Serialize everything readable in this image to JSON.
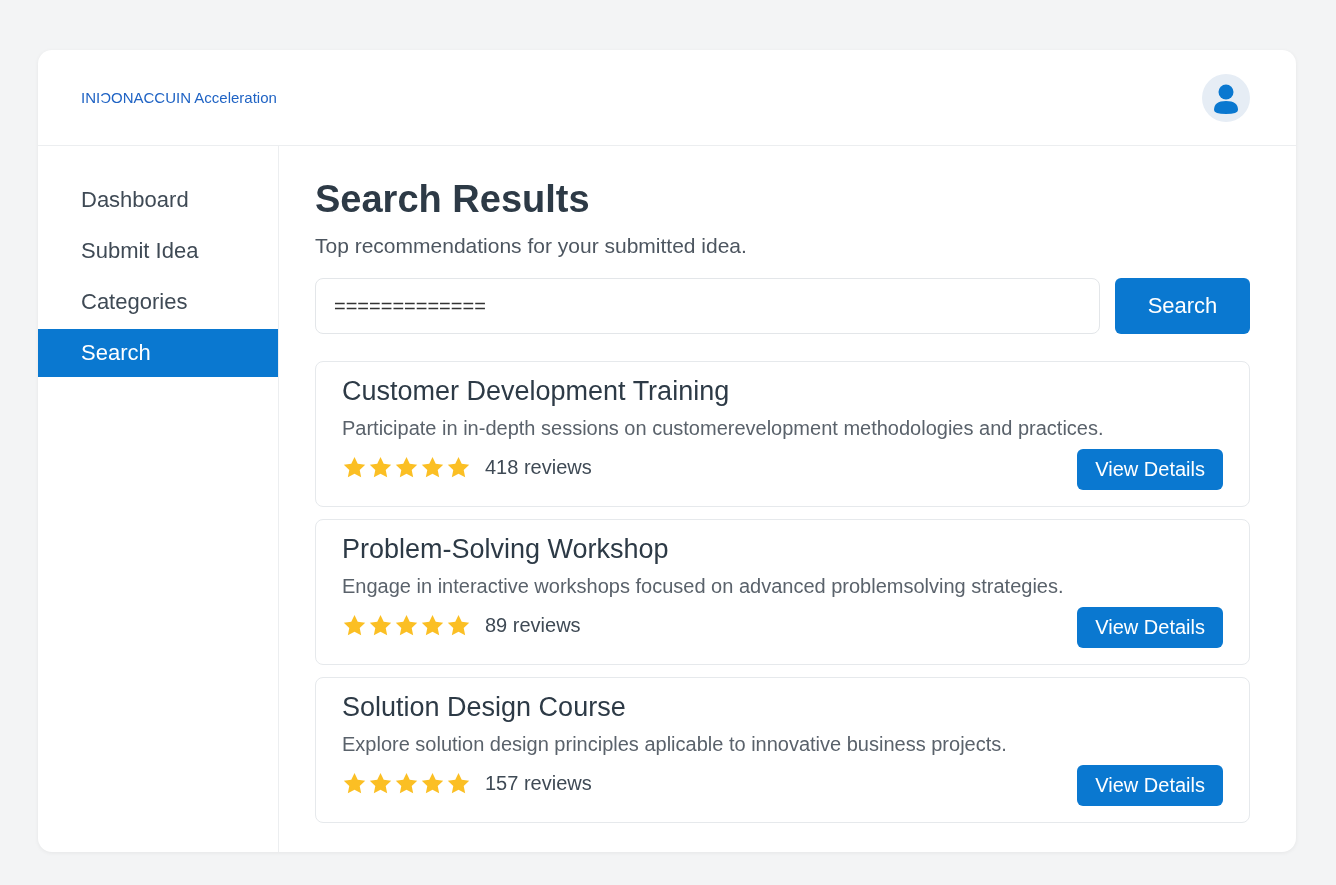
{
  "header": {
    "logo": "INIƆONACCUIN Acceleration"
  },
  "sidebar": {
    "items": [
      {
        "label": "Dashboard",
        "selected": false
      },
      {
        "label": "Submit Idea",
        "selected": false
      },
      {
        "label": "Categories",
        "selected": false
      },
      {
        "label": "Search",
        "selected": true
      }
    ]
  },
  "main": {
    "title": "Search Results",
    "subtitle": "Top recommendations for your submitted idea.",
    "search": {
      "value": "=============",
      "button": "Search"
    },
    "results": [
      {
        "title": "Customer Development Training",
        "description": "Participate in in-depth sessions on customerevelopment methodologies and practices.",
        "stars": 5,
        "reviews": "418 reviews",
        "button": "View Details"
      },
      {
        "title": "Problem-Solving Workshop",
        "description": "Engage in interactive workshops focused on advanced problemsolving strategies.",
        "stars": 5,
        "reviews": "89 reviews",
        "button": "View Details"
      },
      {
        "title": "Solution Design Course",
        "description": "Explore solution design principles aplicable to innovative business projects.",
        "stars": 5,
        "reviews": "157 reviews",
        "button": "View Details"
      }
    ]
  }
}
